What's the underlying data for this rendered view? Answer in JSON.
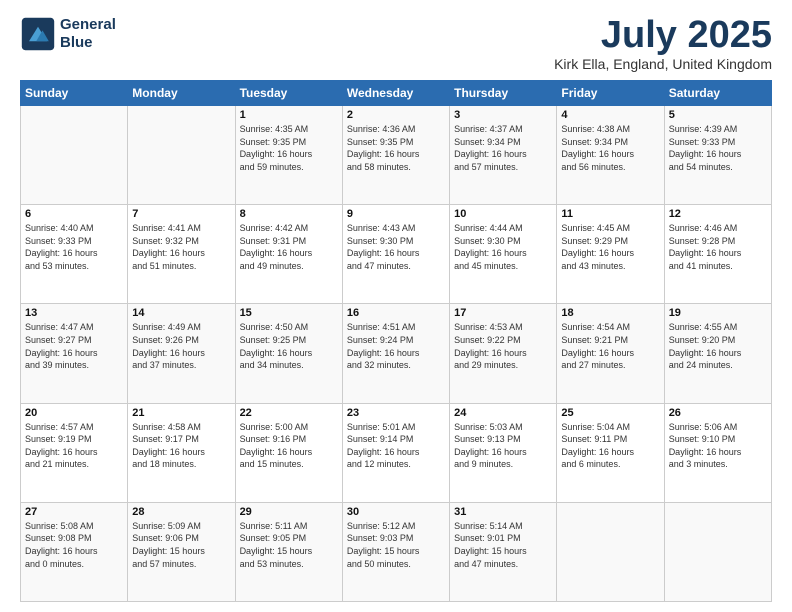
{
  "header": {
    "logo_line1": "General",
    "logo_line2": "Blue",
    "title": "July 2025",
    "location": "Kirk Ella, England, United Kingdom"
  },
  "days_of_week": [
    "Sunday",
    "Monday",
    "Tuesday",
    "Wednesday",
    "Thursday",
    "Friday",
    "Saturday"
  ],
  "weeks": [
    [
      {
        "day": "",
        "info": ""
      },
      {
        "day": "",
        "info": ""
      },
      {
        "day": "1",
        "info": "Sunrise: 4:35 AM\nSunset: 9:35 PM\nDaylight: 16 hours\nand 59 minutes."
      },
      {
        "day": "2",
        "info": "Sunrise: 4:36 AM\nSunset: 9:35 PM\nDaylight: 16 hours\nand 58 minutes."
      },
      {
        "day": "3",
        "info": "Sunrise: 4:37 AM\nSunset: 9:34 PM\nDaylight: 16 hours\nand 57 minutes."
      },
      {
        "day": "4",
        "info": "Sunrise: 4:38 AM\nSunset: 9:34 PM\nDaylight: 16 hours\nand 56 minutes."
      },
      {
        "day": "5",
        "info": "Sunrise: 4:39 AM\nSunset: 9:33 PM\nDaylight: 16 hours\nand 54 minutes."
      }
    ],
    [
      {
        "day": "6",
        "info": "Sunrise: 4:40 AM\nSunset: 9:33 PM\nDaylight: 16 hours\nand 53 minutes."
      },
      {
        "day": "7",
        "info": "Sunrise: 4:41 AM\nSunset: 9:32 PM\nDaylight: 16 hours\nand 51 minutes."
      },
      {
        "day": "8",
        "info": "Sunrise: 4:42 AM\nSunset: 9:31 PM\nDaylight: 16 hours\nand 49 minutes."
      },
      {
        "day": "9",
        "info": "Sunrise: 4:43 AM\nSunset: 9:30 PM\nDaylight: 16 hours\nand 47 minutes."
      },
      {
        "day": "10",
        "info": "Sunrise: 4:44 AM\nSunset: 9:30 PM\nDaylight: 16 hours\nand 45 minutes."
      },
      {
        "day": "11",
        "info": "Sunrise: 4:45 AM\nSunset: 9:29 PM\nDaylight: 16 hours\nand 43 minutes."
      },
      {
        "day": "12",
        "info": "Sunrise: 4:46 AM\nSunset: 9:28 PM\nDaylight: 16 hours\nand 41 minutes."
      }
    ],
    [
      {
        "day": "13",
        "info": "Sunrise: 4:47 AM\nSunset: 9:27 PM\nDaylight: 16 hours\nand 39 minutes."
      },
      {
        "day": "14",
        "info": "Sunrise: 4:49 AM\nSunset: 9:26 PM\nDaylight: 16 hours\nand 37 minutes."
      },
      {
        "day": "15",
        "info": "Sunrise: 4:50 AM\nSunset: 9:25 PM\nDaylight: 16 hours\nand 34 minutes."
      },
      {
        "day": "16",
        "info": "Sunrise: 4:51 AM\nSunset: 9:24 PM\nDaylight: 16 hours\nand 32 minutes."
      },
      {
        "day": "17",
        "info": "Sunrise: 4:53 AM\nSunset: 9:22 PM\nDaylight: 16 hours\nand 29 minutes."
      },
      {
        "day": "18",
        "info": "Sunrise: 4:54 AM\nSunset: 9:21 PM\nDaylight: 16 hours\nand 27 minutes."
      },
      {
        "day": "19",
        "info": "Sunrise: 4:55 AM\nSunset: 9:20 PM\nDaylight: 16 hours\nand 24 minutes."
      }
    ],
    [
      {
        "day": "20",
        "info": "Sunrise: 4:57 AM\nSunset: 9:19 PM\nDaylight: 16 hours\nand 21 minutes."
      },
      {
        "day": "21",
        "info": "Sunrise: 4:58 AM\nSunset: 9:17 PM\nDaylight: 16 hours\nand 18 minutes."
      },
      {
        "day": "22",
        "info": "Sunrise: 5:00 AM\nSunset: 9:16 PM\nDaylight: 16 hours\nand 15 minutes."
      },
      {
        "day": "23",
        "info": "Sunrise: 5:01 AM\nSunset: 9:14 PM\nDaylight: 16 hours\nand 12 minutes."
      },
      {
        "day": "24",
        "info": "Sunrise: 5:03 AM\nSunset: 9:13 PM\nDaylight: 16 hours\nand 9 minutes."
      },
      {
        "day": "25",
        "info": "Sunrise: 5:04 AM\nSunset: 9:11 PM\nDaylight: 16 hours\nand 6 minutes."
      },
      {
        "day": "26",
        "info": "Sunrise: 5:06 AM\nSunset: 9:10 PM\nDaylight: 16 hours\nand 3 minutes."
      }
    ],
    [
      {
        "day": "27",
        "info": "Sunrise: 5:08 AM\nSunset: 9:08 PM\nDaylight: 16 hours\nand 0 minutes."
      },
      {
        "day": "28",
        "info": "Sunrise: 5:09 AM\nSunset: 9:06 PM\nDaylight: 15 hours\nand 57 minutes."
      },
      {
        "day": "29",
        "info": "Sunrise: 5:11 AM\nSunset: 9:05 PM\nDaylight: 15 hours\nand 53 minutes."
      },
      {
        "day": "30",
        "info": "Sunrise: 5:12 AM\nSunset: 9:03 PM\nDaylight: 15 hours\nand 50 minutes."
      },
      {
        "day": "31",
        "info": "Sunrise: 5:14 AM\nSunset: 9:01 PM\nDaylight: 15 hours\nand 47 minutes."
      },
      {
        "day": "",
        "info": ""
      },
      {
        "day": "",
        "info": ""
      }
    ]
  ]
}
